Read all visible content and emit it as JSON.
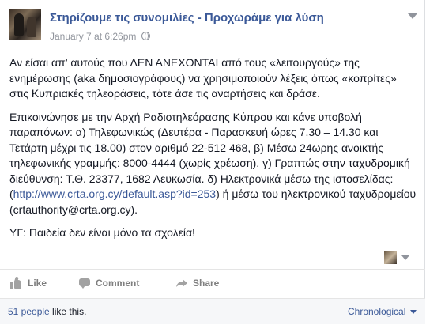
{
  "post": {
    "page_name": "Στηρίζουμε τις συνομιλίες - Προχωράμε για λύση",
    "timestamp": "January 7 at 6:26pm",
    "privacy_icon": "globe-icon",
    "paragraph1": "Αν είσαι απ' αυτούς που ΔΕΝ ΑΝΕΧΟΝΤΑΙ από τους «λειτουργούς» της ενημέρωσης (aka δημοσιογράφους) να χρησιμοποιούν λέξεις όπως «κοπρίτες» στις Κυπριακές τηλεοράσεις, τότε άσε τις αναρτήσεις και δράσε.",
    "paragraph2_before_link": "Επικοινώνησε με την Αρχή Ραδιοτηλεόρασης Κύπρου και κάνε υποβολή παραπόνων: α) Τηλεφωνικώς (Δευτέρα - Παρασκευή ώρες 7.30 – 14.30 και Τετάρτη μέχρι τις 18.00) στον αριθμό 22-512 468, β) Μέσω 24ωρης ανοικτής τηλεφωνικής γραμμής: 8000-4444 (χωρίς χρέωση). γ) Γραπτώς στην ταχυδρομική διεύθυνση: Τ.Θ. 23377, 1682 Λευκωσία. δ) Ηλεκτρονικά μέσω της ιστοσελίδας: (",
    "link_text": "http://www.crta.org.cy/default.asp?id=253",
    "paragraph2_after_link": ") ή μέσω του ηλεκτρονικού ταχυδρομείου (crtauthority@crta.org.cy).",
    "paragraph3": "ΥΓ: Παιδεία δεν είναι μόνο τα σχολεία!"
  },
  "actions": {
    "like_label": "Like",
    "comment_label": "Comment",
    "share_label": "Share"
  },
  "footer": {
    "like_count": "51 people",
    "like_suffix": " like this.",
    "order_label": "Chronological"
  },
  "colors": {
    "link": "#3b5998",
    "text": "#141823",
    "muted": "#90949c"
  }
}
